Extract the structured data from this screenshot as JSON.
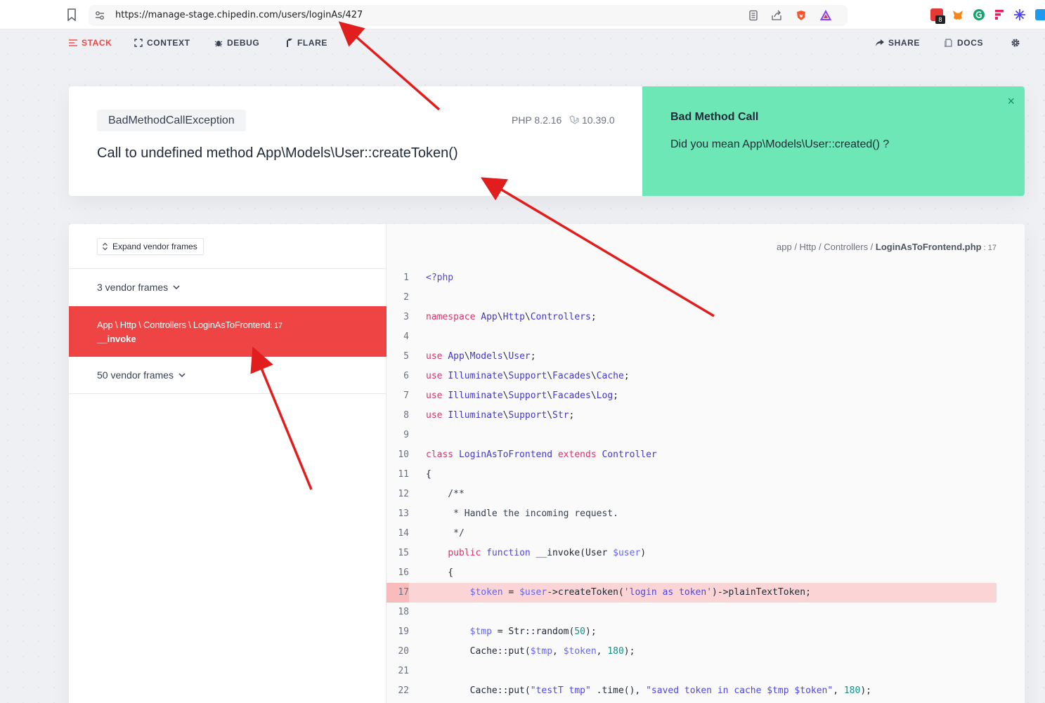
{
  "browser": {
    "url": "https://manage-stage.chipedin.com/users/loginAs/427",
    "extension_badge": "8"
  },
  "nav": {
    "stack": "STACK",
    "context": "CONTEXT",
    "debug": "DEBUG",
    "flare": "FLARE",
    "share": "SHARE",
    "docs": "DOCS"
  },
  "header": {
    "exception_class": "BadMethodCallException",
    "php_version": "PHP 8.2.16",
    "laravel_version": "10.39.0",
    "message": "Call to undefined method App\\Models\\User::createToken()"
  },
  "solution": {
    "title": "Bad Method Call",
    "text": "Did you mean App\\Models\\User::created() ?",
    "close": "×"
  },
  "frames": {
    "expand_label": "Expand vendor frames",
    "vendor_group_1": "3 vendor frames",
    "vendor_group_2": "50 vendor frames",
    "active_class": "App \\ Http \\ Controllers \\ LoginAsToFrontend",
    "active_line": ": 17",
    "active_method": "__invoke"
  },
  "code": {
    "path_prefix": "app / Http / Controllers / ",
    "path_file": "LoginAsToFrontend.php",
    "path_line": " : 17",
    "lines": [
      {
        "n": "1",
        "t": "<?php"
      },
      {
        "n": "2",
        "t": ""
      },
      {
        "n": "3",
        "t": "namespace App\\Http\\Controllers;"
      },
      {
        "n": "4",
        "t": ""
      },
      {
        "n": "5",
        "t": "use App\\Models\\User;"
      },
      {
        "n": "6",
        "t": "use Illuminate\\Support\\Facades\\Cache;"
      },
      {
        "n": "7",
        "t": "use Illuminate\\Support\\Facades\\Log;"
      },
      {
        "n": "8",
        "t": "use Illuminate\\Support\\Str;"
      },
      {
        "n": "9",
        "t": ""
      },
      {
        "n": "10",
        "t": "class LoginAsToFrontend extends Controller"
      },
      {
        "n": "11",
        "t": "{"
      },
      {
        "n": "12",
        "t": "    /**"
      },
      {
        "n": "13",
        "t": "     * Handle the incoming request."
      },
      {
        "n": "14",
        "t": "     */"
      },
      {
        "n": "15",
        "t": "    public function __invoke(User $user)"
      },
      {
        "n": "16",
        "t": "    {"
      },
      {
        "n": "17",
        "t": "        $token = $user->createToken('login as token')->plainTextToken;"
      },
      {
        "n": "18",
        "t": ""
      },
      {
        "n": "19",
        "t": "        $tmp = Str::random(50);"
      },
      {
        "n": "20",
        "t": "        Cache::put($tmp, $token, 180);"
      },
      {
        "n": "21",
        "t": ""
      },
      {
        "n": "22",
        "t": "        Cache::put(\"testT tmp\" .time(), \"saved token in cache $tmp $token\", 180);"
      }
    ],
    "highlight_line": "17"
  },
  "colors": {
    "accent_red": "#ef4444",
    "solution_green": "#6ee7b7",
    "annotation_arrow": "#e11d1d"
  }
}
